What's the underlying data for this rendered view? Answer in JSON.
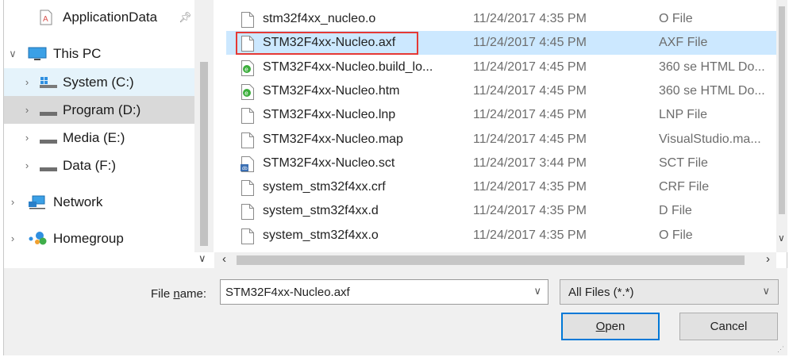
{
  "nav": {
    "items": [
      {
        "label": "ApplicationData",
        "icon": "document-a-icon",
        "pinned": true,
        "expander": "",
        "state": ""
      },
      {
        "label": "This PC",
        "icon": "monitor-icon",
        "expander": "expanded",
        "state": ""
      },
      {
        "label": "System (C:)",
        "icon": "windows-drive-icon",
        "expander": "collapsed",
        "state": "hover"
      },
      {
        "label": "Program (D:)",
        "icon": "drive-icon",
        "expander": "collapsed",
        "state": "selected"
      },
      {
        "label": "Media (E:)",
        "icon": "drive-icon",
        "expander": "collapsed",
        "state": ""
      },
      {
        "label": "Data (F:)",
        "icon": "drive-icon",
        "expander": "collapsed",
        "state": ""
      },
      {
        "label": "Network",
        "icon": "network-icon",
        "expander": "collapsed",
        "state": ""
      },
      {
        "label": "Homegroup",
        "icon": "homegroup-icon",
        "expander": "collapsed",
        "state": ""
      }
    ]
  },
  "files": {
    "rows": [
      {
        "name": "stm32f4xx_nucleo.o",
        "date": "11/24/2017 4:35 PM",
        "type": "O File",
        "icon": "blank-file-icon",
        "selected": false
      },
      {
        "name": "STM32F4xx-Nucleo.axf",
        "date": "11/24/2017 4:45 PM",
        "type": "AXF File",
        "icon": "blank-file-icon",
        "selected": true
      },
      {
        "name": "STM32F4xx-Nucleo.build_lo...",
        "date": "11/24/2017 4:45 PM",
        "type": "360 se HTML Do...",
        "icon": "browser-file-icon",
        "selected": false
      },
      {
        "name": "STM32F4xx-Nucleo.htm",
        "date": "11/24/2017 4:45 PM",
        "type": "360 se HTML Do...",
        "icon": "browser-file-icon",
        "selected": false
      },
      {
        "name": "STM32F4xx-Nucleo.lnp",
        "date": "11/24/2017 4:45 PM",
        "type": "LNP File",
        "icon": "blank-file-icon",
        "selected": false
      },
      {
        "name": "STM32F4xx-Nucleo.map",
        "date": "11/24/2017 4:45 PM",
        "type": "VisualStudio.ma...",
        "icon": "blank-file-icon",
        "selected": false
      },
      {
        "name": "STM32F4xx-Nucleo.sct",
        "date": "11/24/2017 3:44 PM",
        "type": "SCT File",
        "icon": "script-file-icon",
        "selected": false
      },
      {
        "name": "system_stm32f4xx.crf",
        "date": "11/24/2017 4:35 PM",
        "type": "CRF File",
        "icon": "blank-file-icon",
        "selected": false
      },
      {
        "name": "system_stm32f4xx.d",
        "date": "11/24/2017 4:35 PM",
        "type": "D File",
        "icon": "blank-file-icon",
        "selected": false
      },
      {
        "name": "system_stm32f4xx.o",
        "date": "11/24/2017 4:35 PM",
        "type": "O File",
        "icon": "blank-file-icon",
        "selected": false
      }
    ]
  },
  "footer": {
    "filename_label_pre": "File ",
    "filename_label_u": "n",
    "filename_label_post": "ame:",
    "filename_value": "STM32F4xx-Nucleo.axf",
    "filter_value": "All Files (*.*)",
    "open_u": "O",
    "open_rest": "pen",
    "cancel_label": "Cancel"
  },
  "colors": {
    "selection": "#cce8ff",
    "nav_selected": "#d9d9d9",
    "highlight_box": "#e53935",
    "default_button_border": "#0078d7"
  }
}
